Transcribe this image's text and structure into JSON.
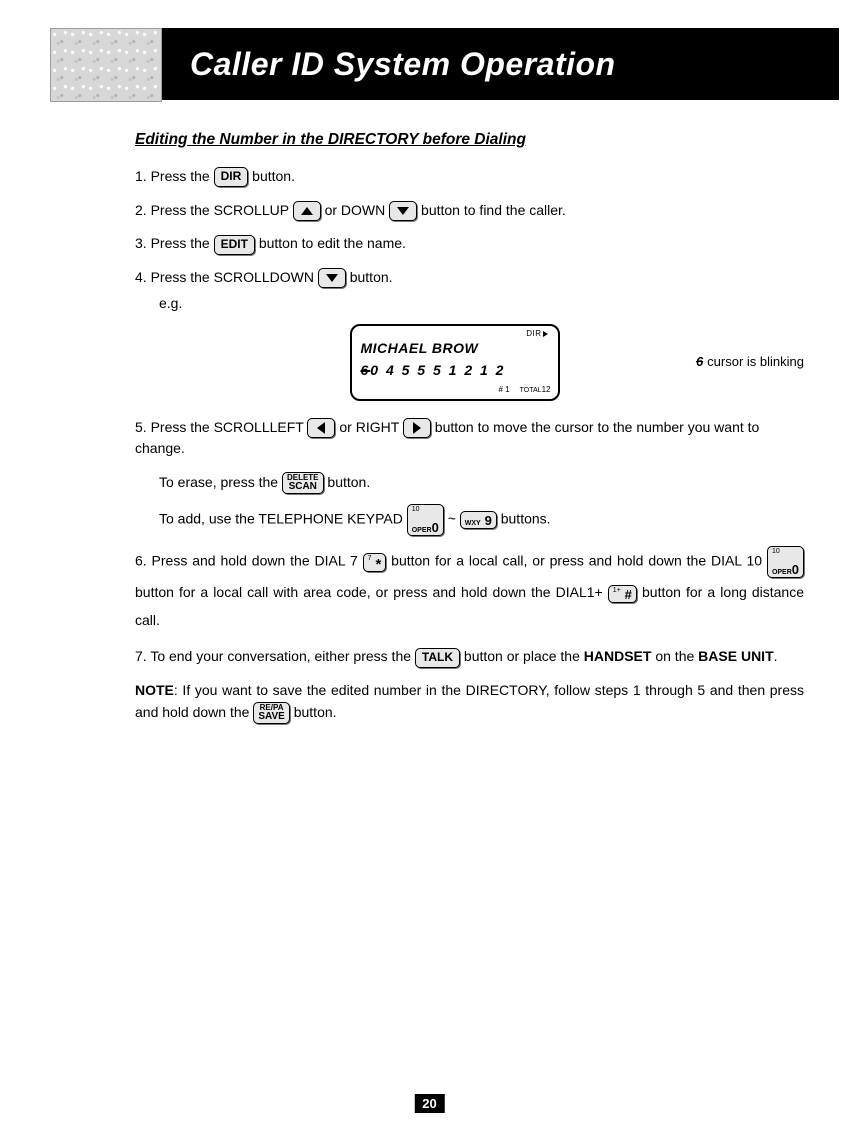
{
  "header": {
    "title": "Caller ID System Operation"
  },
  "section": {
    "title": "Editing the Number in the DIRECTORY before Dialing"
  },
  "steps": {
    "s1a": "1.  Press the ",
    "s1b": " button.",
    "s2a": "2.  Press the SCROLLUP ",
    "s2b": " or DOWN ",
    "s2c": " button to find the caller.",
    "s3a": "3.  Press the ",
    "s3b": " button to edit the name.",
    "s4a": "4.  Press the SCROLLDOWN ",
    "s4b": " button.",
    "eg": "e.g.",
    "s5a": "5.  Press the SCROLLLEFT ",
    "s5b": " or RIGHT ",
    "s5c": " button to move the cursor to the number you want to change.",
    "s5erase_a": "To erase, press the ",
    "s5erase_b": " button.",
    "s5add_a": "To add, use the TELEPHONE KEYPAD ",
    "s5add_tilde": " ~ ",
    "s5add_b": " buttons.",
    "s6a": "6.  Press and hold down the DIAL 7 ",
    "s6b": " button for a local call, or press and hold down the DIAL 10 ",
    "s6c": " button for a local call with area code, or press and hold down the DIAL1+ ",
    "s6d": " button for a long distance call.",
    "s7a": "7.  To end your conversation, either press the ",
    "s7b": " button or place the ",
    "s7handset": "HANDSET",
    "s7c": " on the ",
    "s7base": "BASE UNIT",
    "s7d": ".",
    "note_label": "NOTE",
    "note_a": ":   If you want to save the edited number in the DIRECTORY, follow steps 1 through 5 and then press and hold down the ",
    "note_b": " button."
  },
  "lcd": {
    "dir": "DIR",
    "name": "MICHAEL BROW",
    "number_first": "6",
    "number_rest": "0 4 5 5 5 1 2 1 2",
    "hash": "# 1",
    "total_label": "TOTAL",
    "total_val": "12",
    "cursor_char": "6",
    "cursor_note": " cursor is blinking"
  },
  "buttons": {
    "dir": "DIR",
    "edit": "EDIT",
    "talk": "TALK",
    "delete_top": "DELETE",
    "delete_bot": "SCAN",
    "repa_top": "RE/PA",
    "repa_bot": "SAVE",
    "key0_sup": "10",
    "key0_sub": "OPER",
    "key0_main": "0",
    "key9_sub": "WXY",
    "key9_main": "9",
    "key7_sup": "7",
    "key7_main": "*",
    "keyhash_sup": "1+",
    "keyhash_main": "#"
  },
  "page_number": "20"
}
